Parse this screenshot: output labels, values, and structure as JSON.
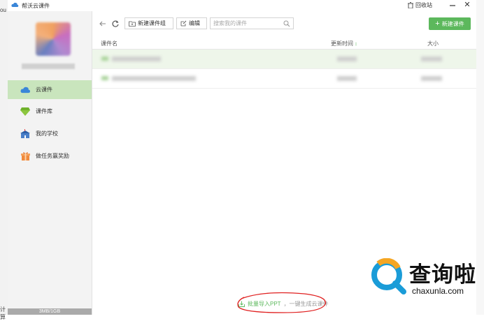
{
  "background_app": {
    "left_text_top": "ou",
    "left_text_bottom": "计算"
  },
  "window": {
    "title": "帮沃云课件",
    "recycle_label": "回收站",
    "close_label": "✕"
  },
  "sidebar": {
    "storage_text": "3MB/1GB",
    "items": [
      {
        "label": "云课件",
        "icon": "cloud-icon",
        "active": true
      },
      {
        "label": "课件库",
        "icon": "diamond-icon",
        "active": false
      },
      {
        "label": "我的学校",
        "icon": "school-icon",
        "active": false
      },
      {
        "label": "做任务赢奖励",
        "icon": "gift-icon",
        "active": false
      }
    ]
  },
  "toolbar": {
    "new_group_label": "新建课件组",
    "edit_label": "编辑",
    "search_placeholder": "搜索我的课件",
    "new_courseware_label": "新建课件"
  },
  "table": {
    "columns": {
      "name": "课件名",
      "updated": "更新时间",
      "updated_sort": "↕",
      "size": "大小"
    }
  },
  "bottom": {
    "import_label": "批量导入PPT",
    "import_hint": "，一键生成云课件"
  },
  "watermark": {
    "text": "查询啦",
    "url": "chaxunla.com"
  },
  "colors": {
    "accent_green": "#5cb85c",
    "active_nav": "#c9e5bd",
    "annotation_red": "#e02020"
  }
}
